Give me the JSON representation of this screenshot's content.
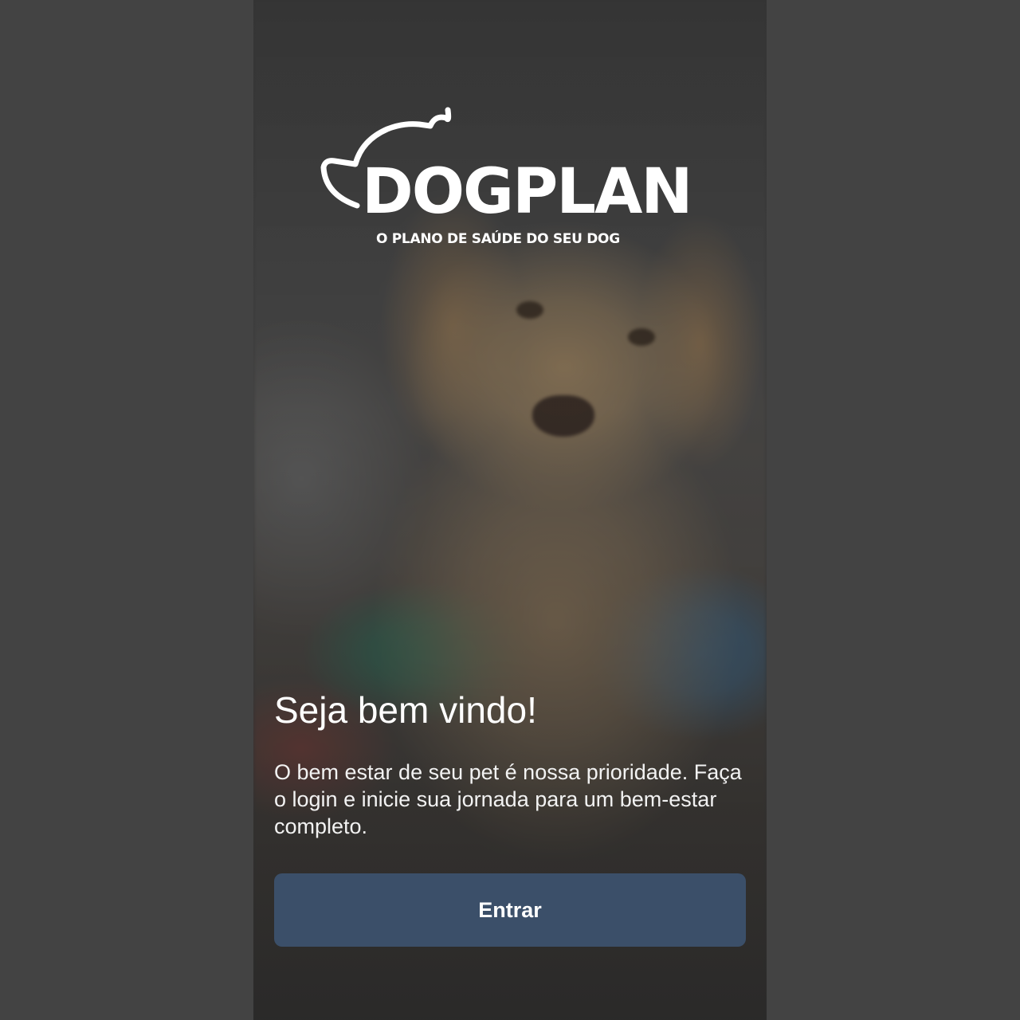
{
  "brand": {
    "name": "DOGPLAN",
    "tagline": "O PLANO DE SAÚDE DO SEU DOG"
  },
  "welcome": {
    "title": "Seja bem vindo!",
    "description": "O bem estar de seu pet é nossa prioridade. Faça o login e inicie sua jornada para um bem-estar completo."
  },
  "actions": {
    "enter_label": "Entrar"
  },
  "colors": {
    "background": "#434343",
    "button": "#3b4f69",
    "text": "#ffffff"
  }
}
